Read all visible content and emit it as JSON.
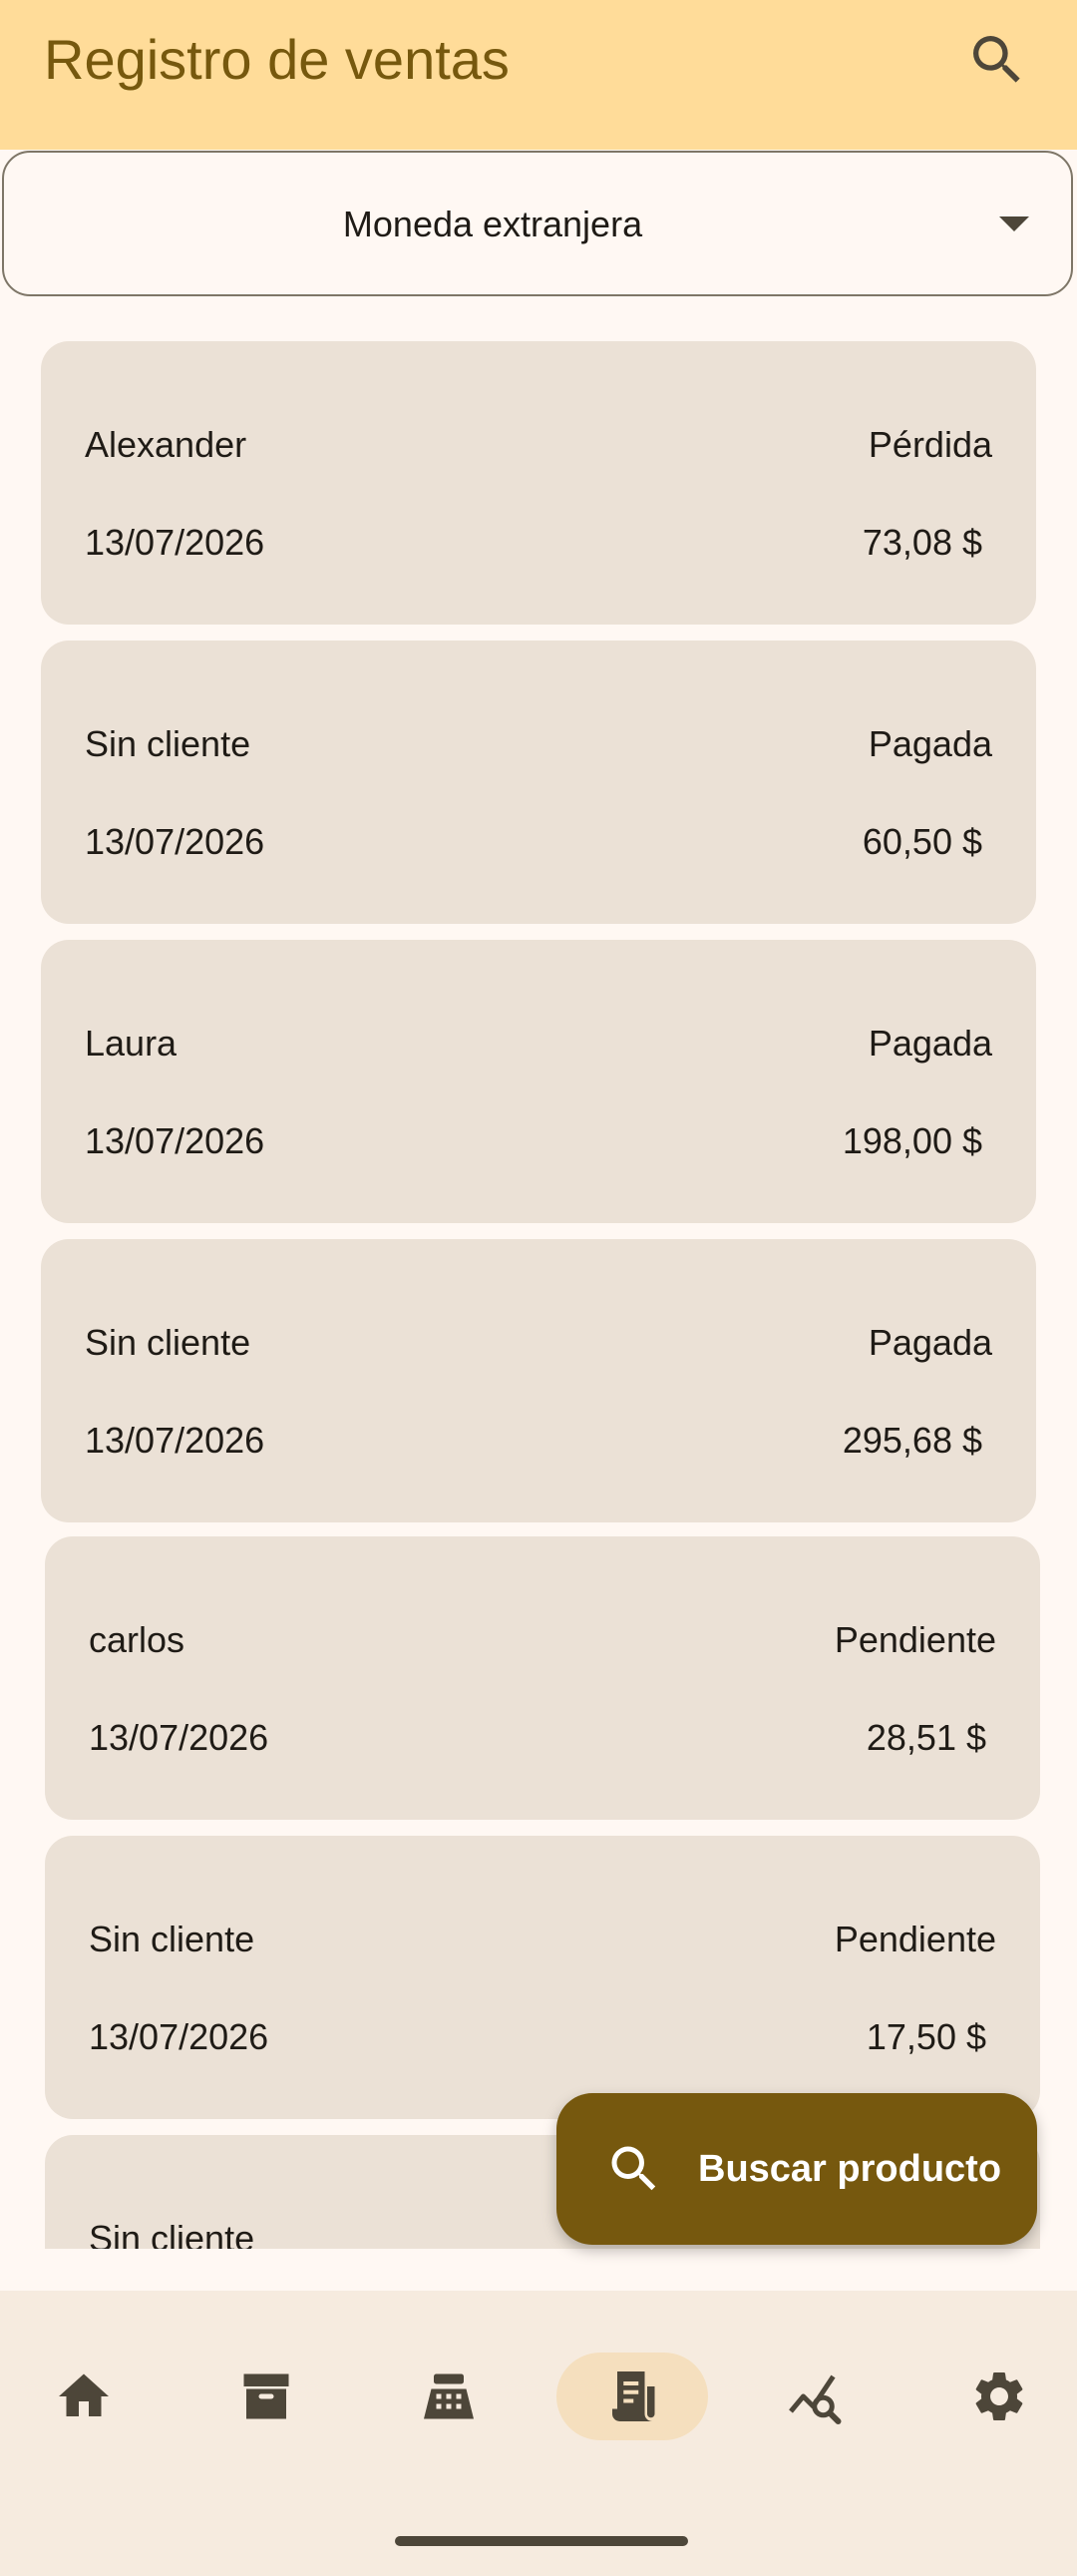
{
  "app_bar": {
    "title": "Registro de ventas",
    "search_icon": "search-icon"
  },
  "currency_select": {
    "selected": "Moneda extranjera",
    "icon": "dropdown-arrow-icon"
  },
  "sales": [
    {
      "client": "Alexander",
      "status": "Pérdida",
      "date": "13/07/2026",
      "amount": "73,08 $"
    },
    {
      "client": "Sin cliente",
      "status": "Pagada",
      "date": "13/07/2026",
      "amount": "60,50 $"
    },
    {
      "client": "Laura",
      "status": "Pagada",
      "date": "13/07/2026",
      "amount": "198,00 $"
    },
    {
      "client": "Sin cliente",
      "status": "Pagada",
      "date": "13/07/2026",
      "amount": "295,68 $"
    },
    {
      "client": "carlos",
      "status": "Pendiente",
      "date": "13/07/2026",
      "amount": "28,51 $"
    },
    {
      "client": "Sin cliente",
      "status": "Pendiente",
      "date": "13/07/2026",
      "amount": "17,50 $"
    },
    {
      "client": "Sin cliente"
    }
  ],
  "fab": {
    "label": "Buscar producto",
    "icon": "search-icon"
  },
  "bottom_nav": {
    "items": [
      {
        "icon": "home-icon",
        "active": false
      },
      {
        "icon": "archive-box-icon",
        "active": false
      },
      {
        "icon": "cash-register-icon",
        "active": false
      },
      {
        "icon": "receipt-icon",
        "active": true
      },
      {
        "icon": "analytics-search-icon",
        "active": false
      },
      {
        "icon": "settings-gear-icon",
        "active": false
      }
    ]
  },
  "colors": {
    "app_bar_bg": "#ffdc99",
    "title_color": "#76580e",
    "card_bg": "#ebe1d6",
    "page_bg": "#fff8f3",
    "fab_bg": "#76580e",
    "nav_bg": "#f6ebdf",
    "nav_active_pill": "#f5dfbe",
    "icon_color": "#4d4639"
  }
}
